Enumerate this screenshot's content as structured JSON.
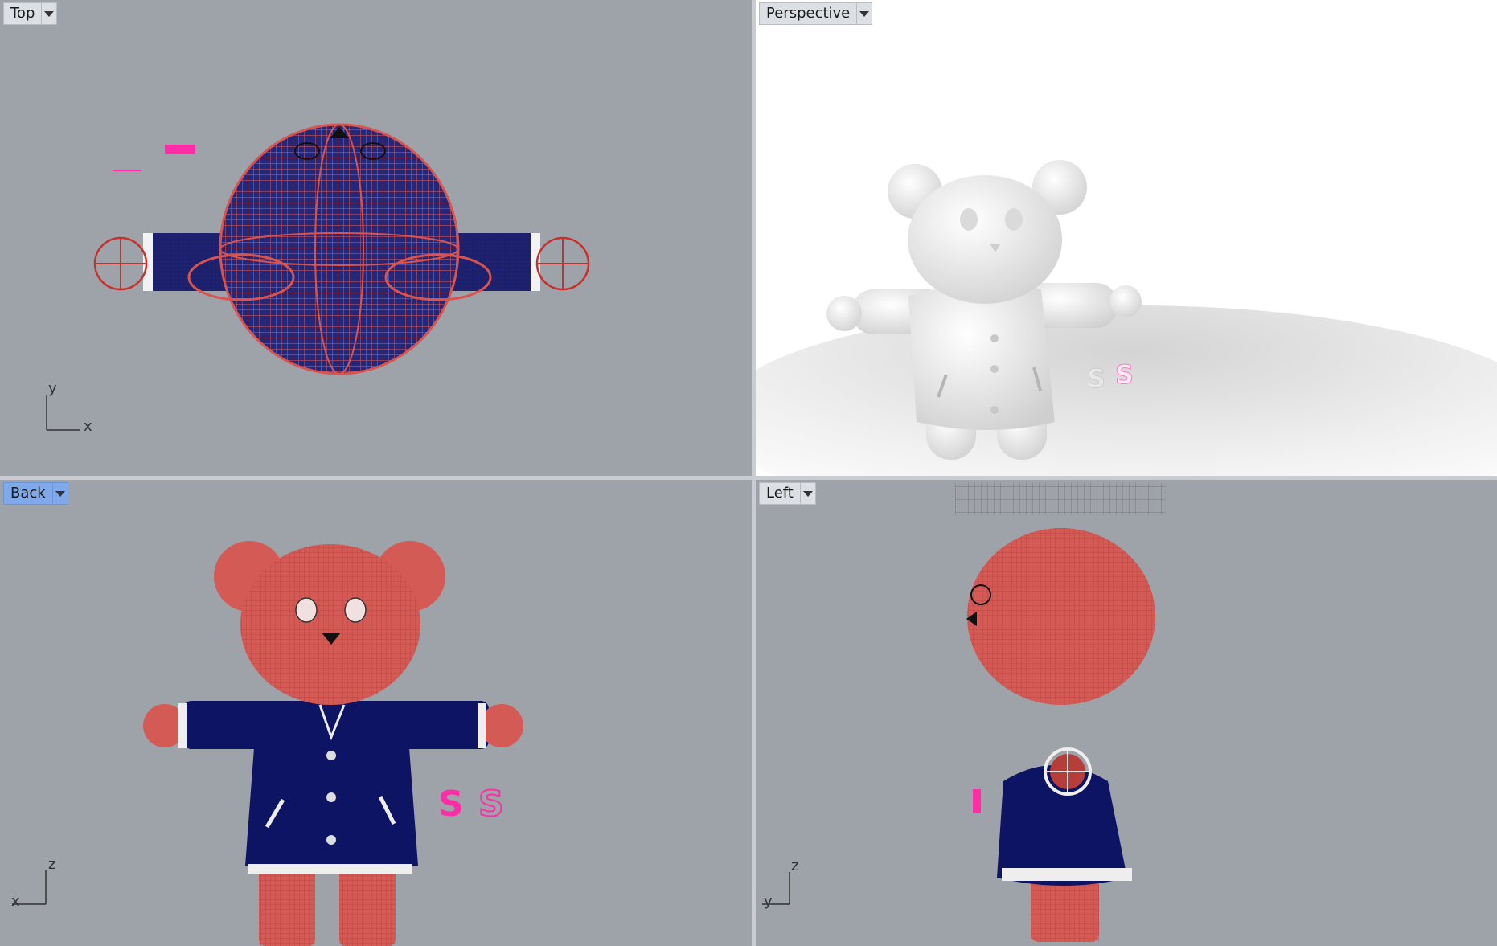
{
  "viewports": {
    "top": {
      "label": "Top",
      "axis_v": "y",
      "axis_h": "x"
    },
    "perspective": {
      "label": "Perspective"
    },
    "back": {
      "label": "Back",
      "axis_v": "z",
      "axis_h": "x"
    },
    "left": {
      "label": "Left",
      "axis_v": "z",
      "axis_h": "y"
    }
  },
  "colors": {
    "viewport_bg": "#9ea3aa",
    "wire_red": "#d9534f",
    "jacket_navy": "#1b1f6e",
    "accent_magenta": "#ff2ea6",
    "active_tab": "#7fa9e8"
  },
  "letters": {
    "s1": "S",
    "s2": "S"
  }
}
